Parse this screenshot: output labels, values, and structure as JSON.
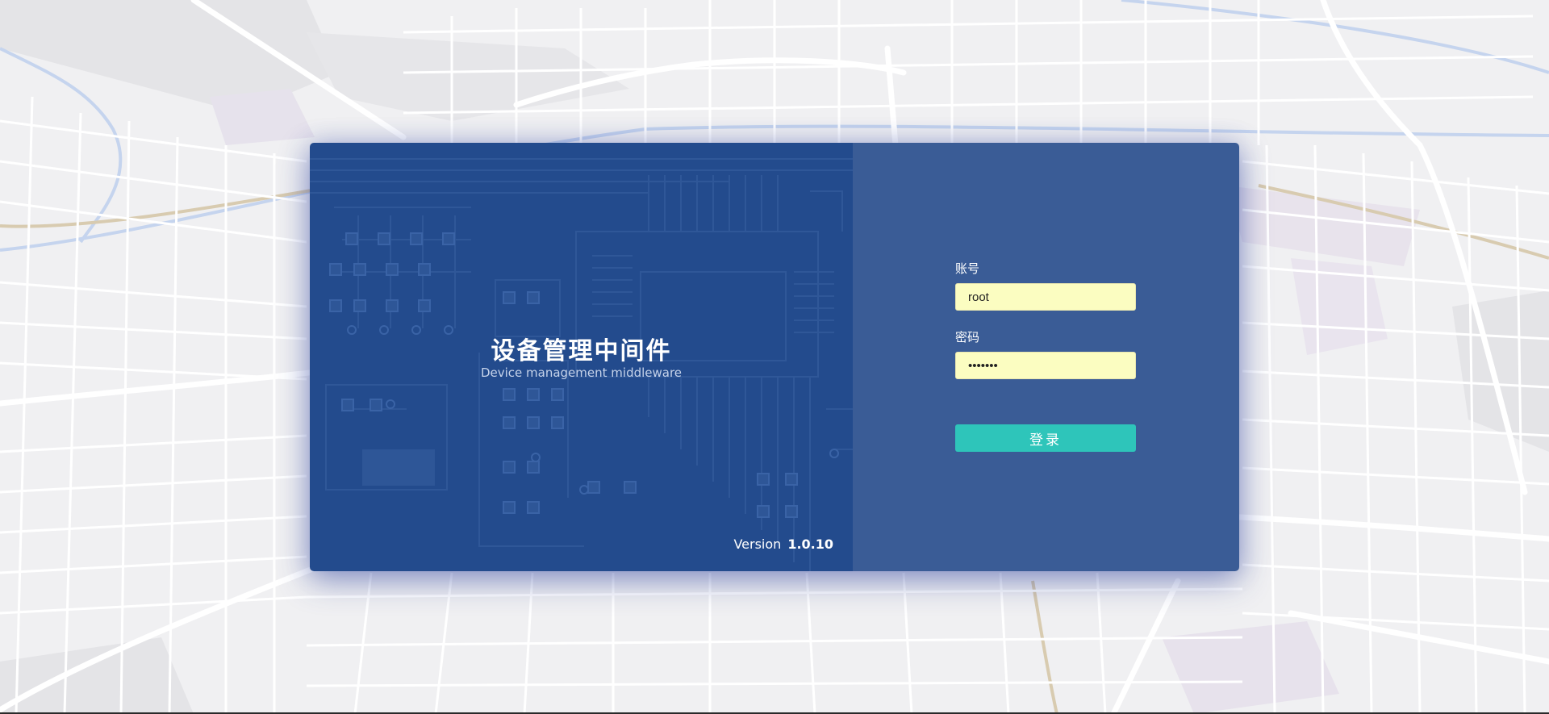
{
  "brand": {
    "title": "设备管理中间件",
    "subtitle": "Device management middleware",
    "version_label": "Version",
    "version_number": "1.0.10"
  },
  "login_form": {
    "account_label": "账号",
    "account_value": "root",
    "password_label": "密码",
    "password_value": "1234567",
    "submit_label": "登录"
  },
  "colors": {
    "brand_panel": "#234b8d",
    "form_panel": "#3a5c96",
    "input_background": "#fbfdc1",
    "button": "#2ec5ba",
    "page_background": "#f1f1f3"
  }
}
